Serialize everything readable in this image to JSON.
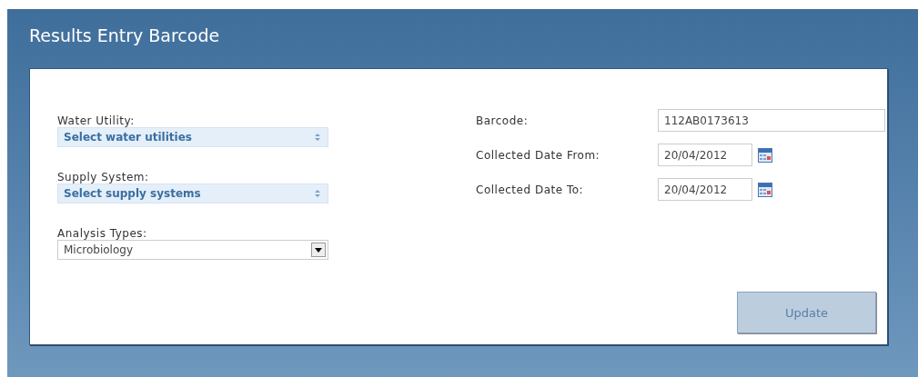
{
  "header": {
    "title": "Results Entry Barcode"
  },
  "left_fields": [
    {
      "label": "Water Utility:",
      "kind": "multiselect",
      "value": "Select water utilities"
    },
    {
      "label": "Supply System:",
      "kind": "multiselect",
      "value": "Select supply systems"
    },
    {
      "label": "Analysis Types:",
      "kind": "dropdown",
      "value": "Microbiology"
    }
  ],
  "right_fields": [
    {
      "label": "Barcode:",
      "kind": "text",
      "value": "112AB0173613"
    },
    {
      "label": "Collected Date From:",
      "kind": "date",
      "value": "20/04/2012"
    },
    {
      "label": "Collected Date To:",
      "kind": "date",
      "value": "20/04/2012"
    }
  ],
  "buttons": [
    {
      "label": "Update",
      "disabled": true
    }
  ]
}
